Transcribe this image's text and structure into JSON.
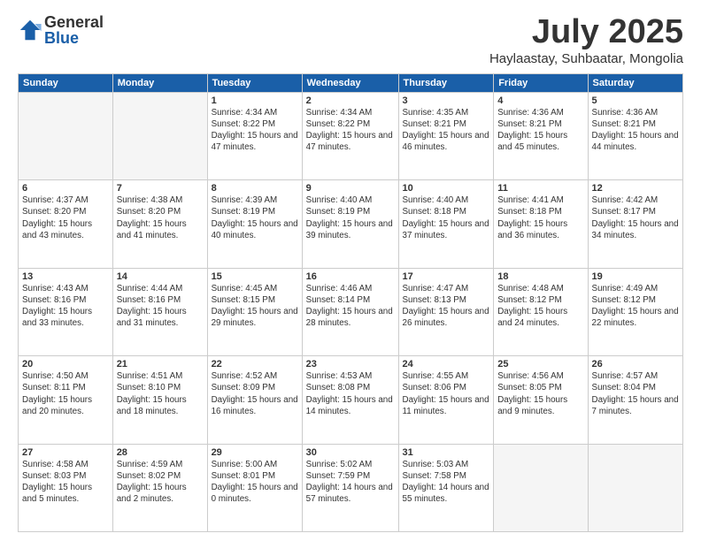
{
  "logo": {
    "general": "General",
    "blue": "Blue"
  },
  "title": {
    "month_year": "July 2025",
    "location": "Haylaastay, Suhbaatar, Mongolia"
  },
  "weekdays": [
    "Sunday",
    "Monday",
    "Tuesday",
    "Wednesday",
    "Thursday",
    "Friday",
    "Saturday"
  ],
  "weeks": [
    [
      {
        "day": "",
        "empty": true
      },
      {
        "day": "",
        "empty": true
      },
      {
        "day": "1",
        "sunrise": "4:34 AM",
        "sunset": "8:22 PM",
        "daylight": "15 hours and 47 minutes."
      },
      {
        "day": "2",
        "sunrise": "4:34 AM",
        "sunset": "8:22 PM",
        "daylight": "15 hours and 47 minutes."
      },
      {
        "day": "3",
        "sunrise": "4:35 AM",
        "sunset": "8:21 PM",
        "daylight": "15 hours and 46 minutes."
      },
      {
        "day": "4",
        "sunrise": "4:36 AM",
        "sunset": "8:21 PM",
        "daylight": "15 hours and 45 minutes."
      },
      {
        "day": "5",
        "sunrise": "4:36 AM",
        "sunset": "8:21 PM",
        "daylight": "15 hours and 44 minutes."
      }
    ],
    [
      {
        "day": "6",
        "sunrise": "4:37 AM",
        "sunset": "8:20 PM",
        "daylight": "15 hours and 43 minutes."
      },
      {
        "day": "7",
        "sunrise": "4:38 AM",
        "sunset": "8:20 PM",
        "daylight": "15 hours and 41 minutes."
      },
      {
        "day": "8",
        "sunrise": "4:39 AM",
        "sunset": "8:19 PM",
        "daylight": "15 hours and 40 minutes."
      },
      {
        "day": "9",
        "sunrise": "4:40 AM",
        "sunset": "8:19 PM",
        "daylight": "15 hours and 39 minutes."
      },
      {
        "day": "10",
        "sunrise": "4:40 AM",
        "sunset": "8:18 PM",
        "daylight": "15 hours and 37 minutes."
      },
      {
        "day": "11",
        "sunrise": "4:41 AM",
        "sunset": "8:18 PM",
        "daylight": "15 hours and 36 minutes."
      },
      {
        "day": "12",
        "sunrise": "4:42 AM",
        "sunset": "8:17 PM",
        "daylight": "15 hours and 34 minutes."
      }
    ],
    [
      {
        "day": "13",
        "sunrise": "4:43 AM",
        "sunset": "8:16 PM",
        "daylight": "15 hours and 33 minutes."
      },
      {
        "day": "14",
        "sunrise": "4:44 AM",
        "sunset": "8:16 PM",
        "daylight": "15 hours and 31 minutes."
      },
      {
        "day": "15",
        "sunrise": "4:45 AM",
        "sunset": "8:15 PM",
        "daylight": "15 hours and 29 minutes."
      },
      {
        "day": "16",
        "sunrise": "4:46 AM",
        "sunset": "8:14 PM",
        "daylight": "15 hours and 28 minutes."
      },
      {
        "day": "17",
        "sunrise": "4:47 AM",
        "sunset": "8:13 PM",
        "daylight": "15 hours and 26 minutes."
      },
      {
        "day": "18",
        "sunrise": "4:48 AM",
        "sunset": "8:12 PM",
        "daylight": "15 hours and 24 minutes."
      },
      {
        "day": "19",
        "sunrise": "4:49 AM",
        "sunset": "8:12 PM",
        "daylight": "15 hours and 22 minutes."
      }
    ],
    [
      {
        "day": "20",
        "sunrise": "4:50 AM",
        "sunset": "8:11 PM",
        "daylight": "15 hours and 20 minutes."
      },
      {
        "day": "21",
        "sunrise": "4:51 AM",
        "sunset": "8:10 PM",
        "daylight": "15 hours and 18 minutes."
      },
      {
        "day": "22",
        "sunrise": "4:52 AM",
        "sunset": "8:09 PM",
        "daylight": "15 hours and 16 minutes."
      },
      {
        "day": "23",
        "sunrise": "4:53 AM",
        "sunset": "8:08 PM",
        "daylight": "15 hours and 14 minutes."
      },
      {
        "day": "24",
        "sunrise": "4:55 AM",
        "sunset": "8:06 PM",
        "daylight": "15 hours and 11 minutes."
      },
      {
        "day": "25",
        "sunrise": "4:56 AM",
        "sunset": "8:05 PM",
        "daylight": "15 hours and 9 minutes."
      },
      {
        "day": "26",
        "sunrise": "4:57 AM",
        "sunset": "8:04 PM",
        "daylight": "15 hours and 7 minutes."
      }
    ],
    [
      {
        "day": "27",
        "sunrise": "4:58 AM",
        "sunset": "8:03 PM",
        "daylight": "15 hours and 5 minutes."
      },
      {
        "day": "28",
        "sunrise": "4:59 AM",
        "sunset": "8:02 PM",
        "daylight": "15 hours and 2 minutes."
      },
      {
        "day": "29",
        "sunrise": "5:00 AM",
        "sunset": "8:01 PM",
        "daylight": "15 hours and 0 minutes."
      },
      {
        "day": "30",
        "sunrise": "5:02 AM",
        "sunset": "7:59 PM",
        "daylight": "14 hours and 57 minutes."
      },
      {
        "day": "31",
        "sunrise": "5:03 AM",
        "sunset": "7:58 PM",
        "daylight": "14 hours and 55 minutes."
      },
      {
        "day": "",
        "empty": true
      },
      {
        "day": "",
        "empty": true
      }
    ]
  ]
}
